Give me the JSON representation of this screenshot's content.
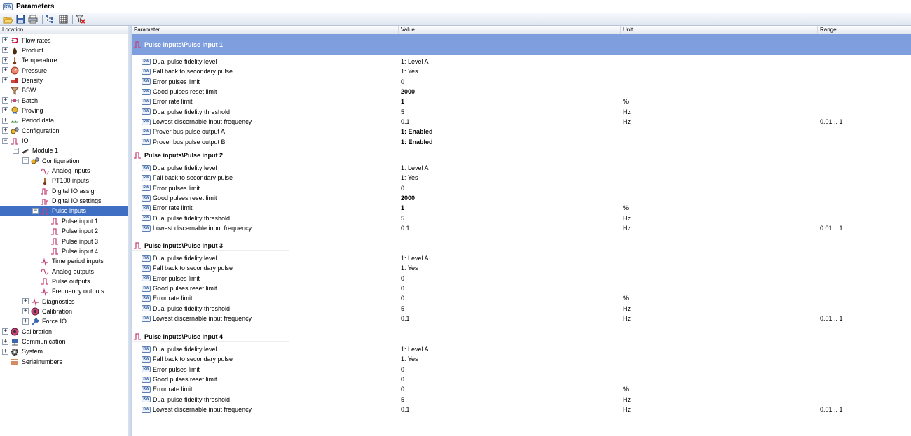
{
  "window": {
    "title": "Parameters",
    "app_badge": "RW"
  },
  "toolbar": {
    "icons": [
      "open-icon",
      "save-icon",
      "print-icon",
      "tree-icon",
      "grid-icon",
      "clear-filter-icon"
    ]
  },
  "sidebar": {
    "header": "Location",
    "nodes": [
      {
        "label": "Flow rates",
        "level": 0,
        "expander": "+",
        "icon": "flow-icon",
        "name": "flow-rates"
      },
      {
        "label": "Product",
        "level": 0,
        "expander": "+",
        "icon": "drop-icon",
        "name": "product"
      },
      {
        "label": "Temperature",
        "level": 0,
        "expander": "+",
        "icon": "thermometer-icon",
        "name": "temperature"
      },
      {
        "label": "Pressure",
        "level": 0,
        "expander": "+",
        "icon": "gauge-icon",
        "name": "pressure"
      },
      {
        "label": "Density",
        "level": 0,
        "expander": "+",
        "icon": "density-icon",
        "name": "density"
      },
      {
        "label": "BSW",
        "level": 0,
        "expander": "",
        "icon": "funnel-icon",
        "name": "bsw"
      },
      {
        "label": "Batch",
        "level": 0,
        "expander": "+",
        "icon": "batch-icon",
        "name": "batch"
      },
      {
        "label": "Proving",
        "level": 0,
        "expander": "+",
        "icon": "medal-icon",
        "name": "proving"
      },
      {
        "label": "Period data",
        "level": 0,
        "expander": "+",
        "icon": "period-icon",
        "name": "period-data"
      },
      {
        "label": "Configuration",
        "level": 0,
        "expander": "+",
        "icon": "gears-icon",
        "name": "configuration"
      },
      {
        "label": "IO",
        "level": 0,
        "expander": "−",
        "icon": "pulse-icon",
        "name": "io"
      },
      {
        "label": "Module 1",
        "level": 1,
        "expander": "−",
        "icon": "module-icon",
        "name": "module-1"
      },
      {
        "label": "Configuration",
        "level": 2,
        "expander": "−",
        "icon": "gears-icon",
        "name": "module-configuration"
      },
      {
        "label": "Analog inputs",
        "level": 3,
        "expander": "",
        "icon": "sine-icon",
        "name": "analog-inputs"
      },
      {
        "label": "PT100 inputs",
        "level": 3,
        "expander": "",
        "icon": "thermometer-icon",
        "name": "pt100-inputs"
      },
      {
        "label": "Digital IO assign",
        "level": 3,
        "expander": "",
        "icon": "digital-icon",
        "name": "digital-io-assign"
      },
      {
        "label": "Digital IO settings",
        "level": 3,
        "expander": "",
        "icon": "digital-icon",
        "name": "digital-io-settings"
      },
      {
        "label": "Pulse inputs",
        "level": 3,
        "expander": "−",
        "icon": "pulse-icon",
        "name": "pulse-inputs",
        "selected": true
      },
      {
        "label": "Pulse input 1",
        "level": 4,
        "expander": "",
        "icon": "pulse-icon",
        "name": "pulse-input-1"
      },
      {
        "label": "Pulse input 2",
        "level": 4,
        "expander": "",
        "icon": "pulse-icon",
        "name": "pulse-input-2"
      },
      {
        "label": "Pulse input 3",
        "level": 4,
        "expander": "",
        "icon": "pulse-icon",
        "name": "pulse-input-3"
      },
      {
        "label": "Pulse input 4",
        "level": 4,
        "expander": "",
        "icon": "pulse-icon",
        "name": "pulse-input-4"
      },
      {
        "label": "Time period inputs",
        "level": 3,
        "expander": "",
        "icon": "heartbeat-icon",
        "name": "time-period-inputs"
      },
      {
        "label": "Analog outputs",
        "level": 3,
        "expander": "",
        "icon": "sine-icon",
        "name": "analog-outputs"
      },
      {
        "label": "Pulse outputs",
        "level": 3,
        "expander": "",
        "icon": "pulse-icon",
        "name": "pulse-outputs"
      },
      {
        "label": "Frequency outputs",
        "level": 3,
        "expander": "",
        "icon": "heartbeat-icon",
        "name": "frequency-outputs"
      },
      {
        "label": "Diagnostics",
        "level": 2,
        "expander": "+",
        "icon": "heartbeat-icon",
        "name": "diagnostics"
      },
      {
        "label": "Calibration",
        "level": 2,
        "expander": "+",
        "icon": "calibration-icon",
        "name": "module-calibration"
      },
      {
        "label": "Force IO",
        "level": 2,
        "expander": "+",
        "icon": "wrench-icon",
        "name": "force-io"
      },
      {
        "label": "Calibration",
        "level": 0,
        "expander": "+",
        "icon": "calibration-icon",
        "name": "calibration"
      },
      {
        "label": "Communication",
        "level": 0,
        "expander": "+",
        "icon": "network-icon",
        "name": "communication"
      },
      {
        "label": "System",
        "level": 0,
        "expander": "+",
        "icon": "gear-icon",
        "name": "system"
      },
      {
        "label": "Serialnumbers",
        "level": 0,
        "expander": "",
        "icon": "serial-icon",
        "name": "serialnumbers"
      }
    ]
  },
  "grid": {
    "columns": {
      "parameter": "Parameter",
      "value": "Value",
      "unit": "Unit",
      "range": "Range"
    },
    "sections": [
      {
        "title": "Pulse inputs\\Pulse input 1",
        "active": true,
        "rows": [
          {
            "name": "Dual pulse fidelity level",
            "value": "1: Level A",
            "unit": "",
            "range": "",
            "bold": false
          },
          {
            "name": "Fall back to secondary pulse",
            "value": "1: Yes",
            "unit": "",
            "range": "",
            "bold": false
          },
          {
            "name": "Error pulses limit",
            "value": "0",
            "unit": "",
            "range": "",
            "bold": false
          },
          {
            "name": "Good pulses reset limit",
            "value": "2000",
            "unit": "",
            "range": "",
            "bold": true
          },
          {
            "name": "Error rate limit",
            "value": "1",
            "unit": "%",
            "range": "",
            "bold": true
          },
          {
            "name": "Dual pulse fidelity threshold",
            "value": "5",
            "unit": "Hz",
            "range": "",
            "bold": false
          },
          {
            "name": "Lowest discernable input frequency",
            "value": "0.1",
            "unit": "Hz",
            "range": "0.01 .. 1",
            "bold": false
          },
          {
            "name": "Prover bus pulse output A",
            "value": "1: Enabled",
            "unit": "",
            "range": "",
            "bold": true
          },
          {
            "name": "Prover bus pulse output B",
            "value": "1: Enabled",
            "unit": "",
            "range": "",
            "bold": true
          }
        ]
      },
      {
        "title": "Pulse inputs\\Pulse input 2",
        "active": false,
        "rows": [
          {
            "name": "Dual pulse fidelity level",
            "value": "1: Level A",
            "unit": "",
            "range": "",
            "bold": false
          },
          {
            "name": "Fall back to secondary pulse",
            "value": "1: Yes",
            "unit": "",
            "range": "",
            "bold": false
          },
          {
            "name": "Error pulses limit",
            "value": "0",
            "unit": "",
            "range": "",
            "bold": false
          },
          {
            "name": "Good pulses reset limit",
            "value": "2000",
            "unit": "",
            "range": "",
            "bold": true
          },
          {
            "name": "Error rate limit",
            "value": "1",
            "unit": "%",
            "range": "",
            "bold": true
          },
          {
            "name": "Dual pulse fidelity threshold",
            "value": "5",
            "unit": "Hz",
            "range": "",
            "bold": false
          },
          {
            "name": "Lowest discernable input frequency",
            "value": "0.1",
            "unit": "Hz",
            "range": "0.01 .. 1",
            "bold": false
          }
        ]
      },
      {
        "title": "Pulse inputs\\Pulse input 3",
        "active": false,
        "rows": [
          {
            "name": "Dual pulse fidelity level",
            "value": "1: Level A",
            "unit": "",
            "range": "",
            "bold": false
          },
          {
            "name": "Fall back to secondary pulse",
            "value": "1: Yes",
            "unit": "",
            "range": "",
            "bold": false
          },
          {
            "name": "Error pulses limit",
            "value": "0",
            "unit": "",
            "range": "",
            "bold": false
          },
          {
            "name": "Good pulses reset limit",
            "value": "0",
            "unit": "",
            "range": "",
            "bold": false
          },
          {
            "name": "Error rate limit",
            "value": "0",
            "unit": "%",
            "range": "",
            "bold": false
          },
          {
            "name": "Dual pulse fidelity threshold",
            "value": "5",
            "unit": "Hz",
            "range": "",
            "bold": false
          },
          {
            "name": "Lowest discernable input frequency",
            "value": "0.1",
            "unit": "Hz",
            "range": "0.01 .. 1",
            "bold": false
          }
        ]
      },
      {
        "title": "Pulse inputs\\Pulse input 4",
        "active": false,
        "rows": [
          {
            "name": "Dual pulse fidelity level",
            "value": "1: Level A",
            "unit": "",
            "range": "",
            "bold": false
          },
          {
            "name": "Fall back to secondary pulse",
            "value": "1: Yes",
            "unit": "",
            "range": "",
            "bold": false
          },
          {
            "name": "Error pulses limit",
            "value": "0",
            "unit": "",
            "range": "",
            "bold": false
          },
          {
            "name": "Good pulses reset limit",
            "value": "0",
            "unit": "",
            "range": "",
            "bold": false
          },
          {
            "name": "Error rate limit",
            "value": "0",
            "unit": "%",
            "range": "",
            "bold": false
          },
          {
            "name": "Dual pulse fidelity threshold",
            "value": "5",
            "unit": "Hz",
            "range": "",
            "bold": false
          },
          {
            "name": "Lowest discernable input frequency",
            "value": "0.1",
            "unit": "Hz",
            "range": "0.01 .. 1",
            "bold": false
          }
        ]
      }
    ]
  },
  "colors": {
    "selected_bg": "#3f6fc2",
    "active_section_bg": "#7f9edd",
    "icon_pink": "#c8457a"
  }
}
